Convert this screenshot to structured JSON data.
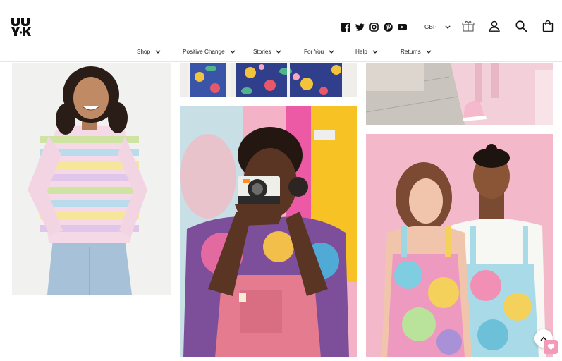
{
  "header": {
    "brand": "Lucy & Yak",
    "social_links": [
      "facebook-icon",
      "twitter-icon",
      "instagram-icon",
      "pinterest-icon",
      "youtube-icon"
    ],
    "currency": "GBP",
    "icons": [
      "gift-icon",
      "account-icon",
      "search-icon",
      "bag-icon"
    ]
  },
  "nav": {
    "items": [
      {
        "label": "Shop"
      },
      {
        "label": "Positive Change"
      },
      {
        "label": "Stories"
      },
      {
        "label": "For You"
      },
      {
        "label": "Help"
      },
      {
        "label": "Returns"
      }
    ]
  },
  "gallery": {
    "photos": [
      {
        "subject": "woman-striped-top"
      },
      {
        "subject": "floral-trousers"
      },
      {
        "subject": "pink-trainers"
      },
      {
        "subject": "man-with-camera"
      },
      {
        "subject": "couple-tie-dye-dungarees"
      }
    ]
  },
  "colors": {
    "accent_pink": "#f39ab8",
    "text": "#222222",
    "nav_border": "#e5e5e5"
  }
}
